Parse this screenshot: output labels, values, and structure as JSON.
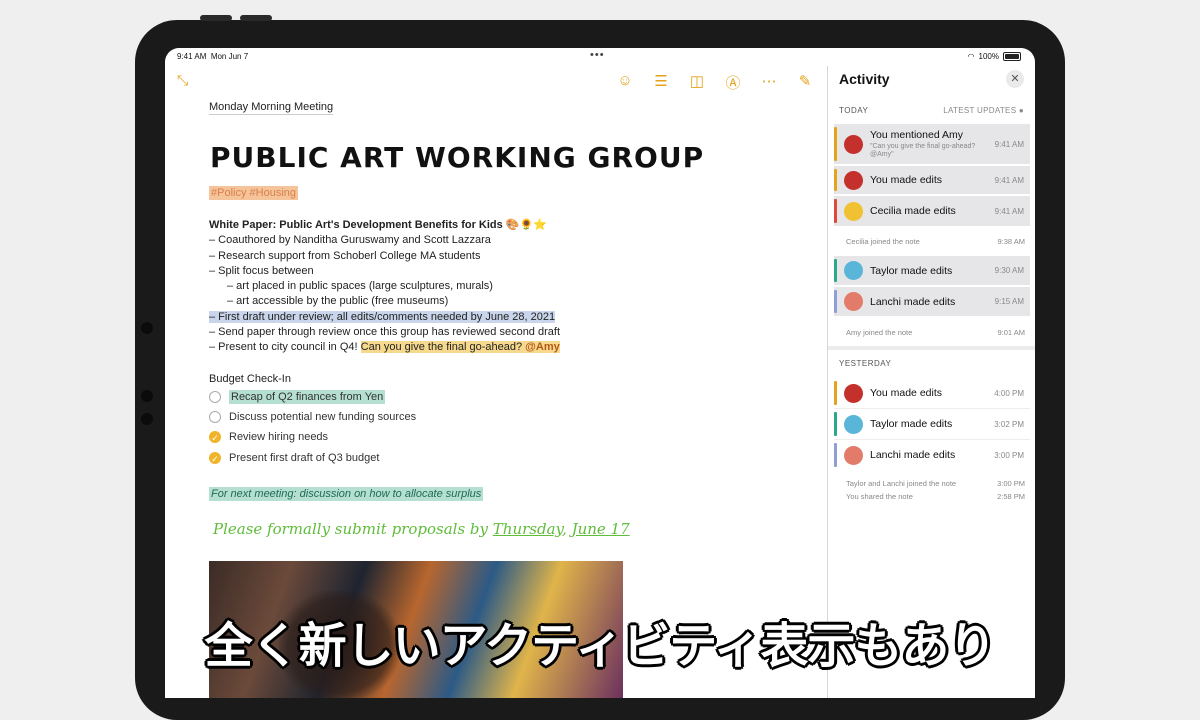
{
  "status": {
    "time": "9:41 AM",
    "date": "Mon Jun 7",
    "dots": "•••",
    "battery": "100%"
  },
  "toolbar": {
    "collapse_icon": "collapse-arrows-icon",
    "icons": [
      "share-person-icon",
      "checklist-icon",
      "camera-icon",
      "markup-pen-icon",
      "more-icon",
      "compose-icon"
    ],
    "accent": "#e5a21c"
  },
  "note": {
    "meeting": "Monday Morning Meeting",
    "title": "PUBLIC ART WORKING GROUP",
    "tags": "#Policy #Housing",
    "white_paper": "White Paper: Public Art's Development Benefits for Kids",
    "emoji": "🎨🌻⭐",
    "line1": "– Coauthored by Nanditha Guruswamy and Scott Lazzara",
    "line2": "– Research support from Schoberl College MA students",
    "line3": "– Split focus between",
    "line4": "– art placed in public spaces (large sculptures, murals)",
    "line5": "– art accessible by the public (free museums)",
    "line6": "– First draft under review; all edits/comments needed by June 28, 2021",
    "line7": "– Send paper through review once this group has reviewed second draft",
    "line8a": "– Present to city council in Q4!",
    "line8b": "Can you give the final go-ahead?",
    "line8c": "@Amy",
    "budget_title": "Budget Check-In",
    "checklist": [
      {
        "label": "Recap of Q2 finances from Yen",
        "done": false
      },
      {
        "label": "Discuss potential new funding sources",
        "done": false
      },
      {
        "label": "Review hiring needs",
        "done": true
      },
      {
        "label": "Present first draft of Q3 budget",
        "done": true
      }
    ],
    "next_meeting": "For next meeting: discussion on how to allocate surplus",
    "handwritten_a": "Please formally submit proposals by ",
    "handwritten_b": "Thursday",
    "handwritten_c": ", ",
    "handwritten_d": "June 17"
  },
  "activity": {
    "title": "Activity",
    "close_icon": "close-icon",
    "today": "TODAY",
    "latest": "LATEST UPDATES",
    "yesterday": "YESTERDAY",
    "items_today": [
      {
        "actor": "You",
        "text": "You mentioned Amy",
        "sub": "\"Can you give the final go-ahead? @Amy\"",
        "time": "9:41 AM",
        "color": "#e5a21c"
      },
      {
        "actor": "You",
        "text": "You made edits",
        "time": "9:41 AM",
        "color": "#e5a21c"
      },
      {
        "actor": "Cecilia",
        "text": "Cecilia made edits",
        "time": "9:41 AM",
        "color": "#e0483a"
      },
      {
        "actor": "Taylor",
        "text": "Taylor made edits",
        "time": "9:30 AM",
        "color": "#2aa889"
      },
      {
        "actor": "Lanchi",
        "text": "Lanchi made edits",
        "time": "9:15 AM",
        "color": "#8f9ed6"
      }
    ],
    "cecilia_joined": "Cecilia joined the note",
    "cecilia_joined_time": "9:38 AM",
    "amy_joined": "Amy joined the note",
    "amy_joined_time": "9:01 AM",
    "items_yesterday": [
      {
        "text": "You made edits",
        "time": "4:00 PM",
        "color": "#e5a21c"
      },
      {
        "text": "Taylor made edits",
        "time": "3:02 PM",
        "color": "#2aa889"
      },
      {
        "text": "Lanchi made edits",
        "time": "3:00 PM",
        "color": "#8f9ed6"
      }
    ],
    "joined_y": "Taylor and Lanchi joined the note",
    "joined_y_time": "3:00 PM",
    "shared_y": "You shared the note",
    "shared_y_time": "2:58 PM"
  },
  "caption": "全く新しいアクティビティ表示もあり"
}
